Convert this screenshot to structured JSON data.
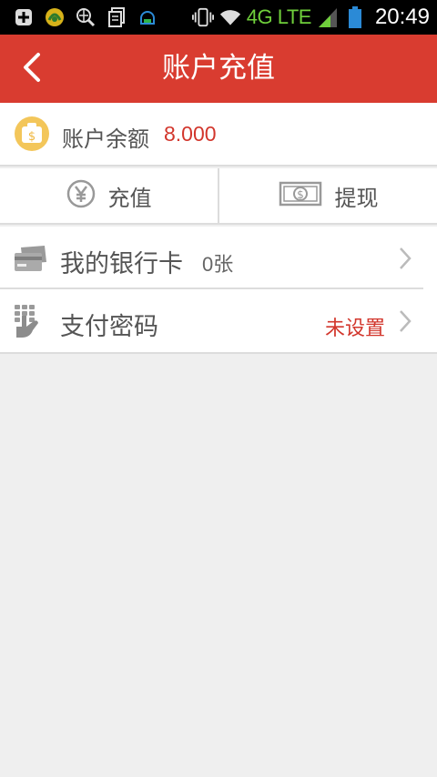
{
  "status_bar": {
    "network": "4G LTE",
    "time": "20:49",
    "icons": [
      "add-icon",
      "app-icon",
      "search-globe-icon",
      "document-icon",
      "message-icon",
      "vibrate-icon",
      "wifi-icon",
      "signal-icon",
      "battery-icon"
    ]
  },
  "header": {
    "title": "账户充值",
    "back_icon": "chevron-left-icon"
  },
  "balance": {
    "label": "账户余额",
    "value": "8.000",
    "icon": "money-bag-icon"
  },
  "actions": [
    {
      "label": "充值",
      "icon": "yen-icon"
    },
    {
      "label": "提现",
      "icon": "banknote-icon"
    }
  ],
  "list": [
    {
      "label": "我的银行卡",
      "detail": "0张",
      "status": "",
      "icon": "bank-card-icon"
    },
    {
      "label": "支付密码",
      "detail": "",
      "status": "未设置",
      "icon": "keypad-hand-icon"
    }
  ],
  "colors": {
    "accent": "#d93c30",
    "accent_text": "#d2362c",
    "background": "#efefef",
    "network_green": "#6fcf3b"
  }
}
